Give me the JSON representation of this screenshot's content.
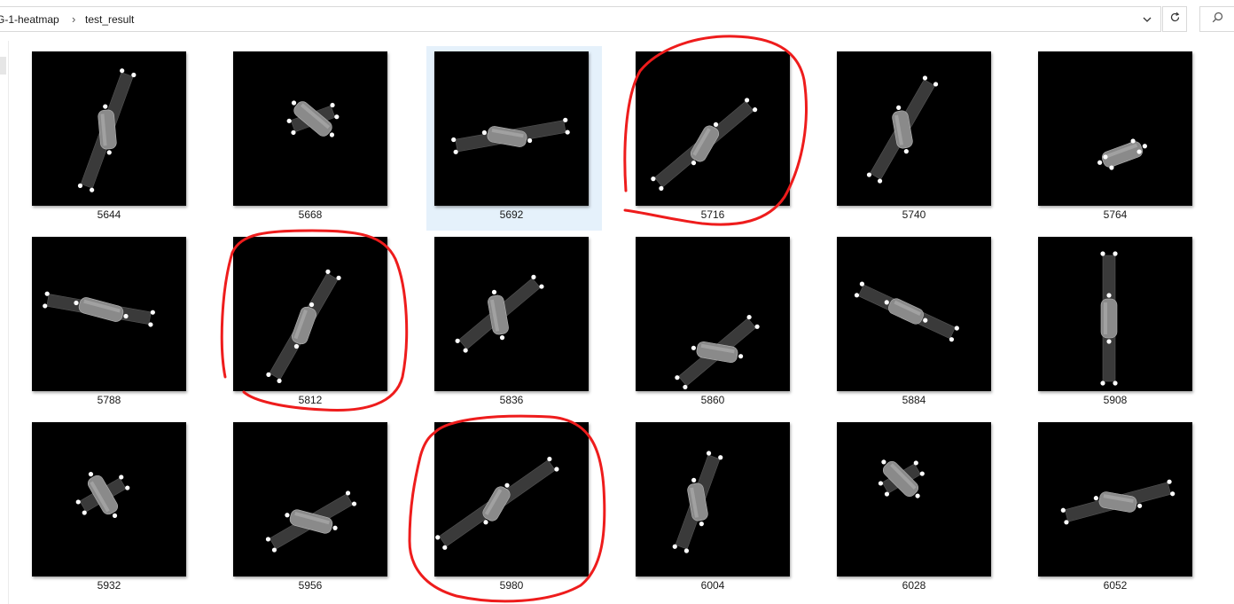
{
  "address_bar": {
    "breadcrumbs": [
      "G-1-heatmap",
      "test_result"
    ],
    "separator": "›"
  },
  "icons": {
    "dropdown": "chevron-down-icon",
    "refresh": "refresh-icon",
    "search": "search-icon"
  },
  "thumbnails": [
    {
      "name": "5644"
    },
    {
      "name": "5668"
    },
    {
      "name": "5692"
    },
    {
      "name": "5716"
    },
    {
      "name": "5740"
    },
    {
      "name": "5764"
    },
    {
      "name": "5788"
    },
    {
      "name": "5812"
    },
    {
      "name": "5836"
    },
    {
      "name": "5860"
    },
    {
      "name": "5884"
    },
    {
      "name": "5908"
    },
    {
      "name": "5932"
    },
    {
      "name": "5956"
    },
    {
      "name": "5980"
    },
    {
      "name": "6004"
    },
    {
      "name": "6028"
    },
    {
      "name": "6052"
    }
  ],
  "selected_thumbnail": "5692",
  "circled_thumbnails": [
    "5716",
    "5812",
    "5980"
  ],
  "colors": {
    "selection": "#e5f1fb",
    "annotation": "#ee1c1c",
    "thumbnail_bg": "#000000"
  }
}
